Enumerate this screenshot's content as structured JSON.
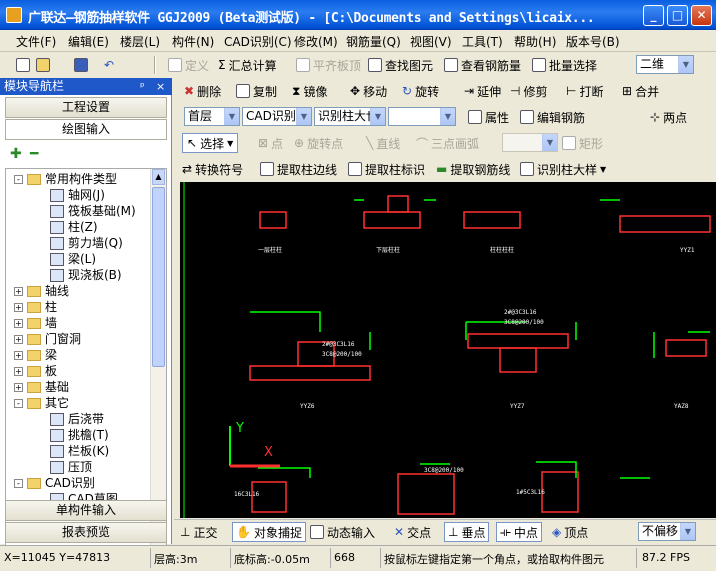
{
  "titlebar": {
    "title": "广联达—钢筋抽样软件 GGJ2009 (Beta测试版) - [C:\\Documents and Settings\\licaix...",
    "min": "_",
    "max": "□",
    "close": "✕"
  },
  "menu": [
    "文件(F)",
    "编辑(E)",
    "楼层(L)",
    "构件(N)",
    "CAD识别(C)",
    "修改(M)",
    "钢筋量(Q)",
    "视图(V)",
    "工具(T)",
    "帮助(H)",
    "版本号(B)"
  ],
  "toolbar1": {
    "define": "定义",
    "sum": "汇总计算",
    "flat": "平齐板顶",
    "find": "查找图元",
    "view_rebar": "查看钢筋量",
    "batch": "批量选择",
    "view_mode": "二维"
  },
  "toolbar2": {
    "delete": "删除",
    "copy": "复制",
    "mirror": "镜像",
    "move": "移动",
    "rotate": "旋转",
    "extend": "延伸",
    "trim": "修剪",
    "break": "打断",
    "merge": "合并"
  },
  "toolbar3": {
    "floor": "首层",
    "cad": "CAD识别",
    "col_detail": "识别柱大†",
    "prop": "属性",
    "edit_rebar": "编辑钢筋",
    "twopoint": "两点"
  },
  "toolbar4": {
    "select": "选择",
    "point": "点",
    "rot_point": "旋转点",
    "line": "直线",
    "arc": "三点画弧",
    "rect": "矩形"
  },
  "toolbar5": {
    "convert": "转换符号",
    "col_edge": "提取柱边线",
    "col_label": "提取柱标识",
    "rebar_line": "提取钢筋线",
    "col_sample": "识别柱大样"
  },
  "nav": {
    "header": "模块导航栏",
    "pin": "ᵖ",
    "close": "×",
    "project": "工程设置",
    "draw": "绘图输入",
    "single": "单构件输入",
    "report": "报表预览"
  },
  "tree": [
    {
      "label": "常用构件类型",
      "level": 0,
      "type": "folder",
      "exp": "-"
    },
    {
      "label": "轴网(J)",
      "level": 1,
      "type": "leaf"
    },
    {
      "label": "筏板基础(M)",
      "level": 1,
      "type": "leaf"
    },
    {
      "label": "柱(Z)",
      "level": 1,
      "type": "leaf"
    },
    {
      "label": "剪力墙(Q)",
      "level": 1,
      "type": "leaf"
    },
    {
      "label": "梁(L)",
      "level": 1,
      "type": "leaf"
    },
    {
      "label": "现浇板(B)",
      "level": 1,
      "type": "leaf"
    },
    {
      "label": "轴线",
      "level": 0,
      "type": "folder",
      "exp": "+"
    },
    {
      "label": "柱",
      "level": 0,
      "type": "folder",
      "exp": "+"
    },
    {
      "label": "墙",
      "level": 0,
      "type": "folder",
      "exp": "+"
    },
    {
      "label": "门窗洞",
      "level": 0,
      "type": "folder",
      "exp": "+"
    },
    {
      "label": "梁",
      "level": 0,
      "type": "folder",
      "exp": "+"
    },
    {
      "label": "板",
      "level": 0,
      "type": "folder",
      "exp": "+"
    },
    {
      "label": "基础",
      "level": 0,
      "type": "folder",
      "exp": "+"
    },
    {
      "label": "其它",
      "level": 0,
      "type": "folder",
      "exp": "-"
    },
    {
      "label": "后浇带",
      "level": 1,
      "type": "leaf"
    },
    {
      "label": "挑檐(T)",
      "level": 1,
      "type": "leaf"
    },
    {
      "label": "栏板(K)",
      "level": 1,
      "type": "leaf"
    },
    {
      "label": "压顶",
      "level": 1,
      "type": "leaf"
    },
    {
      "label": "CAD识别",
      "level": 0,
      "type": "folder",
      "exp": "-"
    },
    {
      "label": "CAD草图",
      "level": 1,
      "type": "leaf"
    }
  ],
  "cad": {
    "labels": [
      "一层柱柱",
      "下层柱柱",
      "柱柱柱柱",
      "YYZ1",
      "YYZ6",
      "YYZ7",
      "YAZ8"
    ],
    "specs": [
      "2#@3C3L16",
      "3C8@200/100",
      "2#@3C3L16",
      "3C8@200/100",
      "16C3L16",
      "3C8@200/100",
      "1#5C3L16"
    ],
    "axis_y": "Y",
    "axis_x": "X"
  },
  "snapbar": {
    "ortho": "正交",
    "snap": "对象捕捉",
    "dyn": "动态输入",
    "cross": "交点",
    "perp": "垂点",
    "mid": "中点",
    "vertex": "顶点",
    "offset": "不偏移"
  },
  "status": {
    "coords": "X=11045 Y=47813",
    "floor_h": "层高:3m",
    "base_h": "底标高:-0.05m",
    "num": "668",
    "hint": "按鼠标左键指定第一个角点，或拾取构件图元",
    "fps": "87.2 FPS"
  }
}
